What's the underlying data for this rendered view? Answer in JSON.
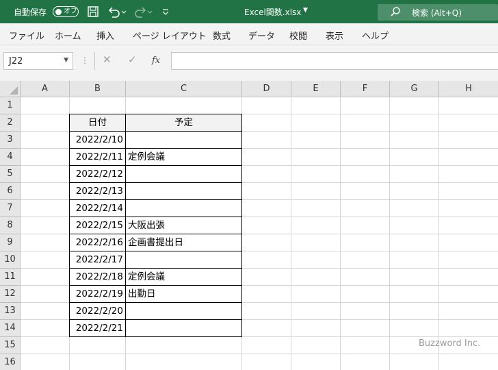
{
  "titlebar": {
    "autosave_label": "自動保存",
    "autosave_state": "オフ",
    "save_icon": "save-icon",
    "undo_icon": "undo-icon",
    "redo_icon": "redo-icon",
    "customize_icon": "customize-qat-icon",
    "doc_title": "Excel関数.xlsx",
    "search_placeholder": "検索 (Alt+Q)",
    "brand_color": "#217346"
  },
  "menu": {
    "tabs": [
      "ファイル",
      "ホーム",
      "挿入",
      "ページ レイアウト",
      "数式",
      "データ",
      "校閲",
      "表示",
      "ヘルプ"
    ]
  },
  "formula_bar": {
    "name_box": "J22",
    "cancel_symbol": "✕",
    "enter_symbol": "✓",
    "fx_symbol": "fx",
    "formula": ""
  },
  "sheet": {
    "columns": [
      "A",
      "B",
      "C",
      "D",
      "E",
      "F",
      "G",
      "H"
    ],
    "rows": [
      "1",
      "2",
      "3",
      "4",
      "5",
      "6",
      "7",
      "8",
      "9",
      "10",
      "11",
      "12",
      "13",
      "14",
      "15",
      "16"
    ],
    "table_headers": [
      "日付",
      "予定"
    ],
    "table_rows": [
      [
        "2022/2/10",
        ""
      ],
      [
        "2022/2/11",
        "定例会議"
      ],
      [
        "2022/2/12",
        ""
      ],
      [
        "2022/2/13",
        ""
      ],
      [
        "2022/2/14",
        ""
      ],
      [
        "2022/2/15",
        "大阪出張"
      ],
      [
        "2022/2/16",
        "企画書提出日"
      ],
      [
        "2022/2/17",
        ""
      ],
      [
        "2022/2/18",
        "定例会議"
      ],
      [
        "2022/2/19",
        "出勤日"
      ],
      [
        "2022/2/20",
        ""
      ],
      [
        "2022/2/21",
        ""
      ]
    ]
  },
  "watermark": "Buzzword Inc."
}
